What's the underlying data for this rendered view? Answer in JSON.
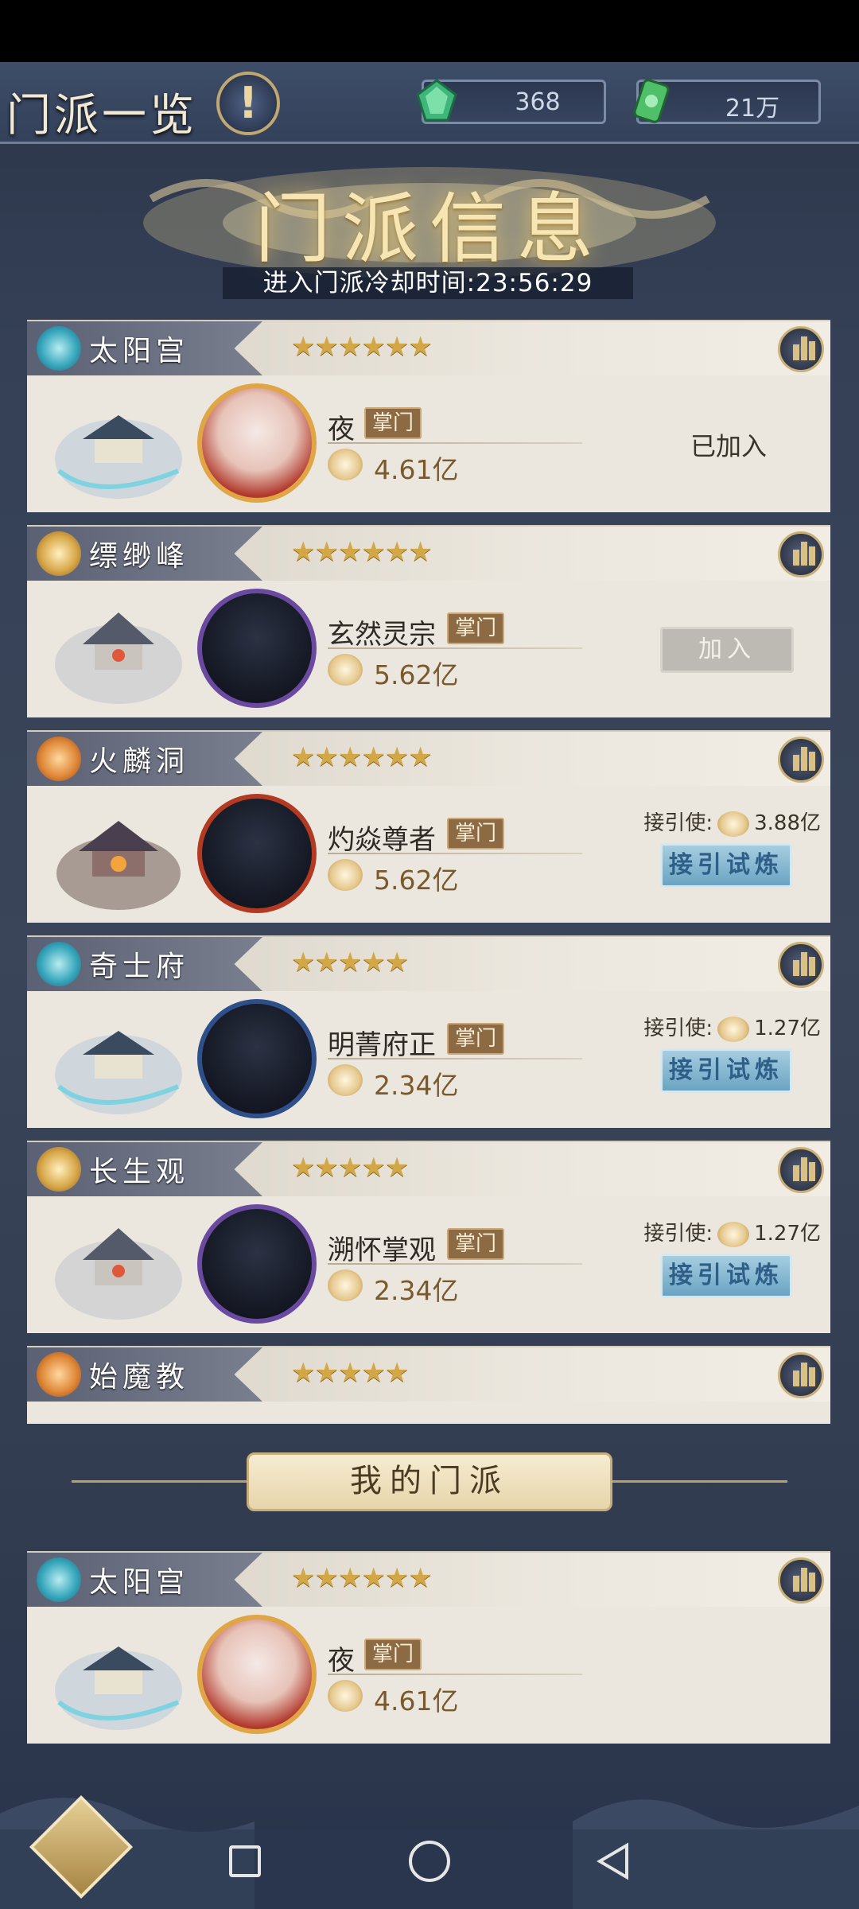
{
  "header": {
    "title": "门派一览",
    "info_button": "!",
    "currency": [
      {
        "icon": "green-jade-icon",
        "value": "368"
      },
      {
        "icon": "jade-token-icon",
        "value": "21万"
      }
    ]
  },
  "banner": {
    "title": "门派信息",
    "cooldown": "进入门派冷却时间:23:56:29"
  },
  "sects": [
    {
      "name": "太阳宫",
      "emblem": "sun-emblem-icon",
      "stars": "★★★★★★",
      "leader": "夜",
      "role": "掌门",
      "power": "4.61亿",
      "status": "已加入"
    },
    {
      "name": "缥缈峰",
      "emblem": "lotus-emblem-icon",
      "stars": "★★★★★★",
      "leader": "玄然灵宗",
      "role": "掌门",
      "power": "5.62亿",
      "join": "加入"
    },
    {
      "name": "火麟洞",
      "emblem": "fire-emblem-icon",
      "stars": "★★★★★★",
      "leader": "灼焱尊者",
      "role": "掌门",
      "power": "5.62亿",
      "envoy_label": "接引使:",
      "envoy_power": "3.88亿",
      "trial": "接引试炼"
    },
    {
      "name": "奇士府",
      "emblem": "sun-emblem-icon",
      "stars": "★★★★★",
      "leader": "明菁府正",
      "role": "掌门",
      "power": "2.34亿",
      "envoy_label": "接引使:",
      "envoy_power": "1.27亿",
      "trial": "接引试炼"
    },
    {
      "name": "长生观",
      "emblem": "lotus-emblem-icon",
      "stars": "★★★★★",
      "leader": "溯怀掌观",
      "role": "掌门",
      "power": "2.34亿",
      "envoy_label": "接引使:",
      "envoy_power": "1.27亿",
      "trial": "接引试炼"
    },
    {
      "name": "始魔教",
      "emblem": "fire-emblem-icon",
      "stars": "★★★★★"
    }
  ],
  "my_sect_label": "我的门派",
  "my_sect": {
    "name": "太阳宫",
    "stars": "★★★★★★",
    "leader": "夜",
    "role": "掌门",
    "power": "4.61亿"
  },
  "colors": {
    "accent_gold": "#d3a745",
    "trial_blue": "#6aa4c2",
    "background": "#354057"
  }
}
